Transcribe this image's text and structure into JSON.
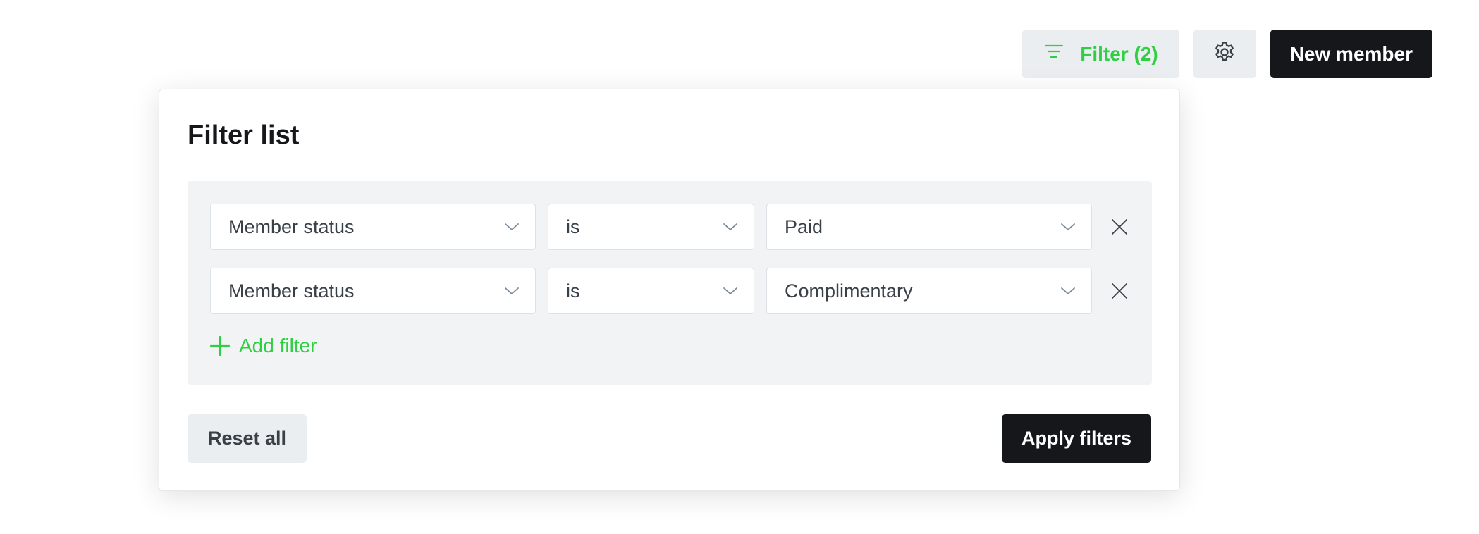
{
  "toolbar": {
    "filter_label": "Filter (2)",
    "settings_icon": "gear-icon",
    "new_member_label": "New member"
  },
  "filter_panel": {
    "title": "Filter list",
    "rows": [
      {
        "field": "Member status",
        "operator": "is",
        "value": "Paid"
      },
      {
        "field": "Member status",
        "operator": "is",
        "value": "Complimentary"
      }
    ],
    "add_filter_label": "Add filter",
    "reset_label": "Reset all",
    "apply_label": "Apply filters"
  },
  "colors": {
    "accent_green": "#30cf43",
    "dark": "#15171a",
    "button_gray": "#ebeef0",
    "panel_inner": "#f1f3f4"
  }
}
